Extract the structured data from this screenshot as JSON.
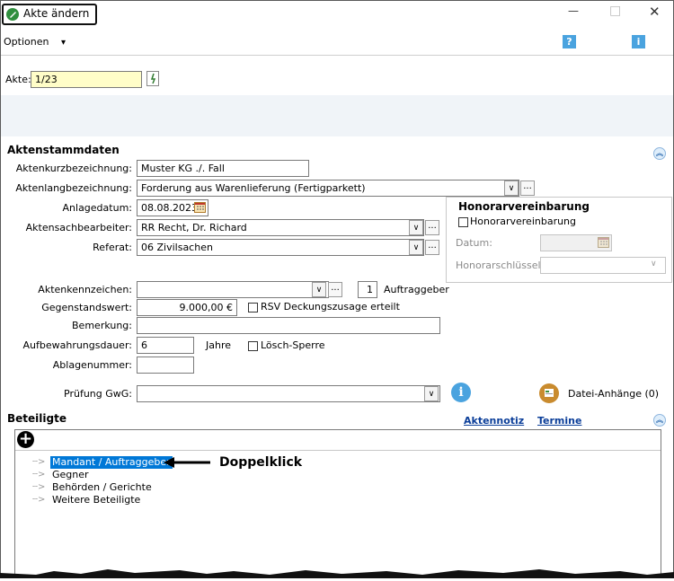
{
  "window": {
    "title": "Akte ändern",
    "minimize_glyph": "—",
    "maximize_glyph": "□",
    "close_glyph": "✕"
  },
  "menu": {
    "options_label": "Optionen",
    "options_arrow": "▾",
    "help_glyph": "?",
    "info_glyph": "i"
  },
  "akte": {
    "label": "Akte:",
    "value": "1/23",
    "pin_glyph": "⸗"
  },
  "stammdaten": {
    "section_title": "Aktenstammdaten",
    "collapse_glyph": "︽",
    "kurzbezeichnung_label": "Aktenkurzbezeichnung:",
    "kurzbezeichnung_value": "Muster KG ./. Fall",
    "langbezeichnung_label": "Aktenlangbezeichnung:",
    "langbezeichnung_value": "Forderung aus Warenlieferung (Fertigparkett)",
    "anlagedatum_label": "Anlagedatum:",
    "anlagedatum_value": "08.08.2023",
    "sachbearbeiter_label": "Aktensachbearbeiter:",
    "sachbearbeiter_value": "RR   Recht, Dr. Richard",
    "referat_label": "Referat:",
    "referat_value": "06  Zivilsachen",
    "kennzeichen_label": "Aktenkennzeichen:",
    "kennzeichen_value": "",
    "auftraggeber_count": "1",
    "auftraggeber_label": "Auftraggeber",
    "gegenstandswert_label": "Gegenstandswert:",
    "gegenstandswert_value": "9.000,00 €",
    "rsv_label": "RSV Deckungszusage erteilt",
    "bemerkung_label": "Bemerkung:",
    "bemerkung_value": "",
    "aufbewahrung_label": "Aufbewahrungsdauer:",
    "aufbewahrung_value": "6",
    "jahre_label": "Jahre",
    "loesch_label": "Lösch-Sperre",
    "ablagenummer_label": "Ablagenummer:",
    "ablagenummer_value": "",
    "gwg_label": "Prüfung GwG:",
    "gwg_value": "",
    "attachments_label": "Datei-Anhänge (0)",
    "dots": "...",
    "dd_arrow": "∨"
  },
  "honorar": {
    "title": "Honorarvereinbarung",
    "checkbox_label": "Honorarvereinbarung",
    "datum_label": "Datum:",
    "datum_value": "",
    "schluessel_label": "Honorarschlüssel:",
    "schluessel_value": ""
  },
  "beteiligte": {
    "section_title": "Beteiligte",
    "aktennotiz_link": "Aktennotiz",
    "termine_link": "Termine",
    "add_glyph": "+",
    "tree": [
      {
        "label": "Mandant / Auftraggeber",
        "selected": true
      },
      {
        "label": "Gegner",
        "selected": false
      },
      {
        "label": "Behörden / Gerichte",
        "selected": false
      },
      {
        "label": "Weitere Beteiligte",
        "selected": false
      }
    ],
    "annotation": "Doppelklick"
  },
  "colors": {
    "selection_bg": "#0078d7",
    "link": "#0b3e99",
    "yellow_field": "#fffdc8",
    "help_blue": "#4aa3df"
  }
}
